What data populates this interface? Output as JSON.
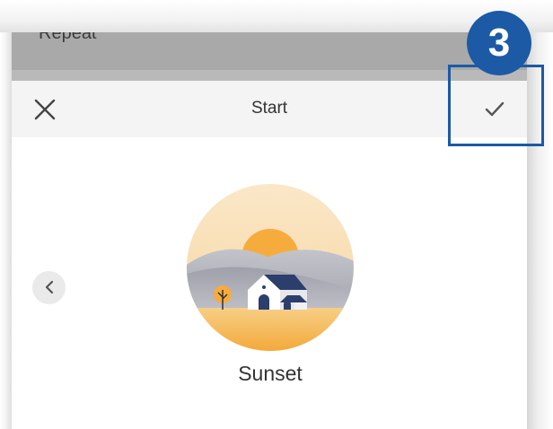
{
  "background_panel": {
    "label": "Repeat"
  },
  "dialog": {
    "title": "Start",
    "close_icon": "close-icon",
    "confirm_icon": "check-icon"
  },
  "scene": {
    "name": "Sunset",
    "prev_icon": "chevron-left-icon"
  },
  "annotation": {
    "step": "3",
    "color": "#1c5aa5"
  }
}
